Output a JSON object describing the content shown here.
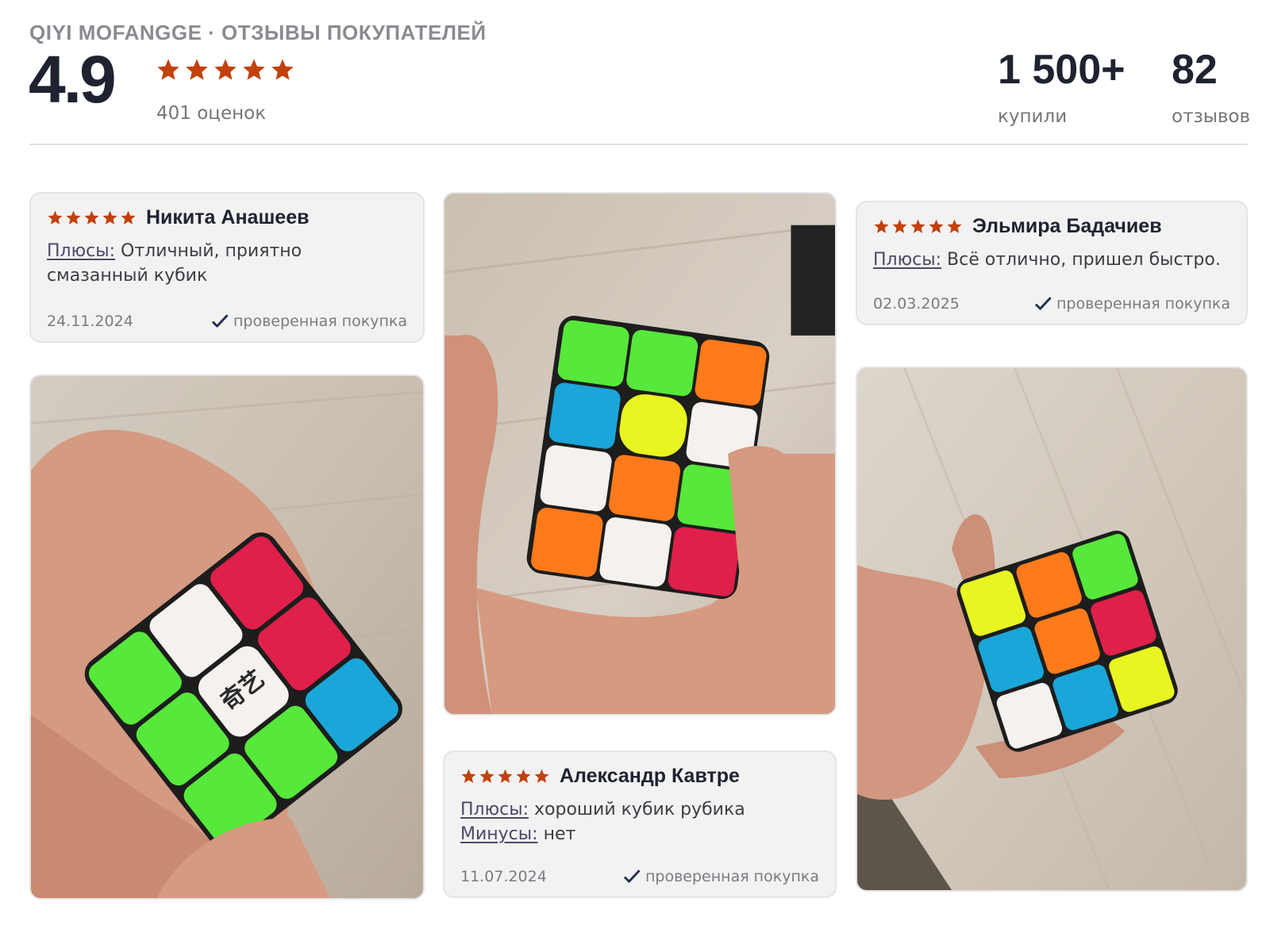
{
  "header": {
    "title": "QIYI MOFANGGE · ОТЗЫВЫ ПОКУПАТЕЛЕЙ",
    "score": "4.9",
    "stars": 5,
    "ratings_count": "401 оценок"
  },
  "stats": [
    {
      "value": "1 500+",
      "label": "купили"
    },
    {
      "value": "82",
      "label": "отзывов"
    }
  ],
  "reviews": [
    {
      "author": "Никита Анашеев",
      "stars": 5,
      "pros_label": "Плюсы:",
      "pros": "Отличный, приятно смазанный кубик",
      "date": "24.11.2024",
      "verified": "проверенная покупка"
    },
    {
      "author": "Эльмира Бадачиев",
      "stars": 5,
      "pros_label": "Плюсы:",
      "pros": "Всё отлично, пришел быстро.",
      "date": "02.03.2025",
      "verified": "проверенная покупка"
    },
    {
      "author": "Александр Кавтре",
      "stars": 5,
      "pros_label": "Плюсы:",
      "pros": "хороший кубик рубика",
      "cons_label": "Минусы:",
      "cons": "нет",
      "date": "11.07.2024",
      "verified": "проверенная покупка"
    }
  ],
  "colors": {
    "star": "#c2410c",
    "check": "#22304f",
    "cube_green": "#56e83a",
    "cube_red": "#e0204a",
    "cube_orange": "#ff7a1a",
    "cube_blue": "#1aa6d8",
    "cube_white": "#f4f1ee",
    "cube_yellow": "#e8f520"
  }
}
